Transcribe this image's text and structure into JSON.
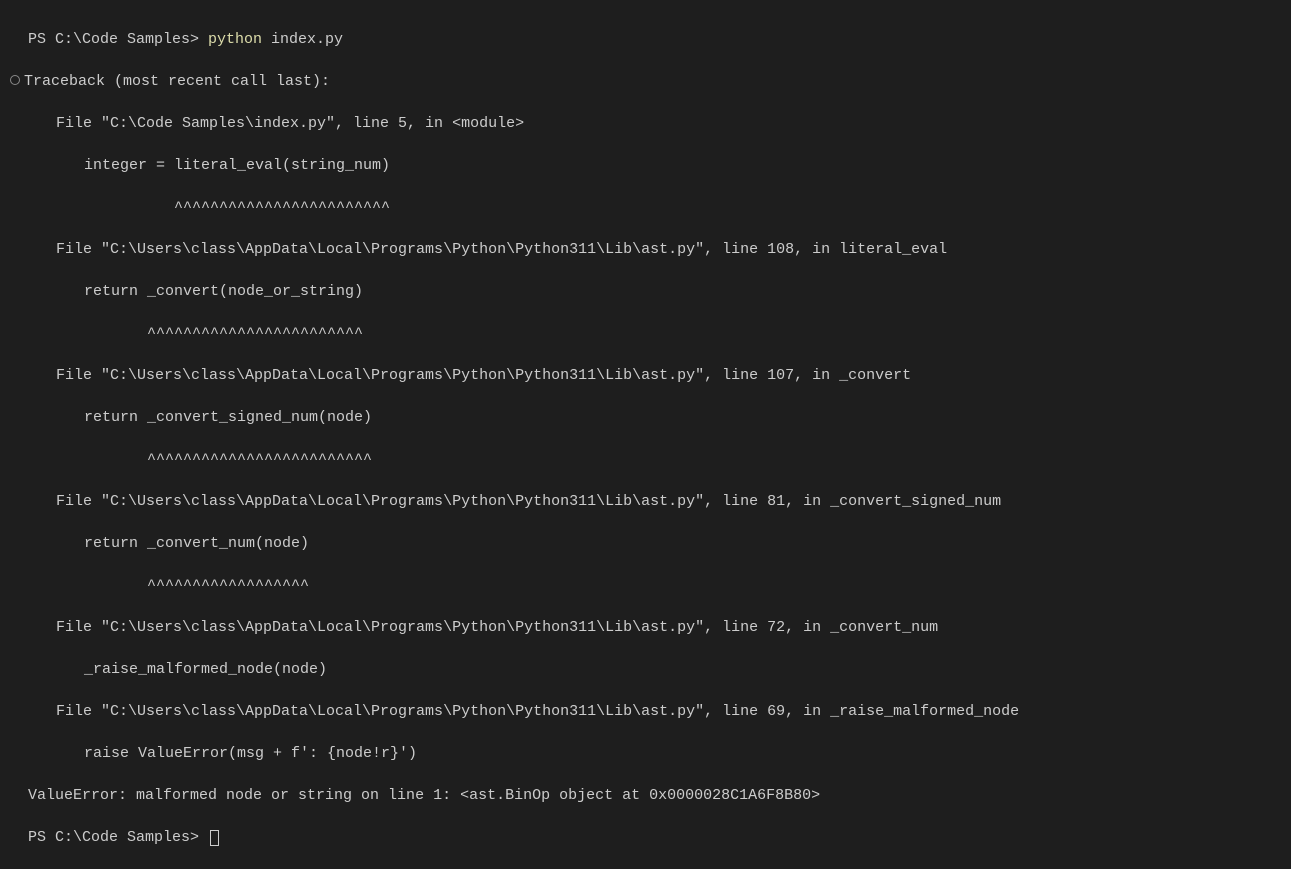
{
  "prompt1": {
    "prefix": "PS C:\\Code Samples> ",
    "command_keyword": "python",
    "command_arg": " index.py"
  },
  "traceback": {
    "header": "Traceback (most recent call last):",
    "frames": [
      {
        "file_line": "File \"C:\\Code Samples\\index.py\", line 5, in <module>",
        "code": "integer = literal_eval(string_num)",
        "carets": "          ^^^^^^^^^^^^^^^^^^^^^^^^"
      },
      {
        "file_line": "File \"C:\\Users\\class\\AppData\\Local\\Programs\\Python\\Python311\\Lib\\ast.py\", line 108, in literal_eval",
        "code": "return _convert(node_or_string)",
        "carets": "       ^^^^^^^^^^^^^^^^^^^^^^^^"
      },
      {
        "file_line": "File \"C:\\Users\\class\\AppData\\Local\\Programs\\Python\\Python311\\Lib\\ast.py\", line 107, in _convert",
        "code": "return _convert_signed_num(node)",
        "carets": "       ^^^^^^^^^^^^^^^^^^^^^^^^^"
      },
      {
        "file_line": "File \"C:\\Users\\class\\AppData\\Local\\Programs\\Python\\Python311\\Lib\\ast.py\", line 81, in _convert_signed_num",
        "code": "return _convert_num(node)",
        "carets": "       ^^^^^^^^^^^^^^^^^^"
      },
      {
        "file_line": "File \"C:\\Users\\class\\AppData\\Local\\Programs\\Python\\Python311\\Lib\\ast.py\", line 72, in _convert_num",
        "code": "_raise_malformed_node(node)",
        "carets": ""
      },
      {
        "file_line": "File \"C:\\Users\\class\\AppData\\Local\\Programs\\Python\\Python311\\Lib\\ast.py\", line 69, in _raise_malformed_node",
        "code": "raise ValueError(msg + f': {node!r}')",
        "carets": ""
      }
    ],
    "error": "ValueError: malformed node or string on line 1: <ast.BinOp object at 0x0000028C1A6F8B80>"
  },
  "prompt2": {
    "prefix": "PS C:\\Code Samples> "
  }
}
